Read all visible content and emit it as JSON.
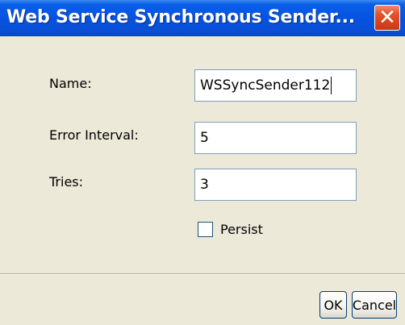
{
  "dialog": {
    "title": "Web Service Synchronous Sender...",
    "close_icon": "close-icon"
  },
  "form": {
    "name_label": "Name:",
    "name_value": "WSSyncSender112",
    "error_interval_label": "Error Interval:",
    "error_interval_value": "5",
    "tries_label": "Tries:",
    "tries_value": "3",
    "persist_label": "Persist",
    "persist_checked": false
  },
  "buttons": {
    "ok_label": "OK",
    "cancel_label": "Cancel"
  }
}
